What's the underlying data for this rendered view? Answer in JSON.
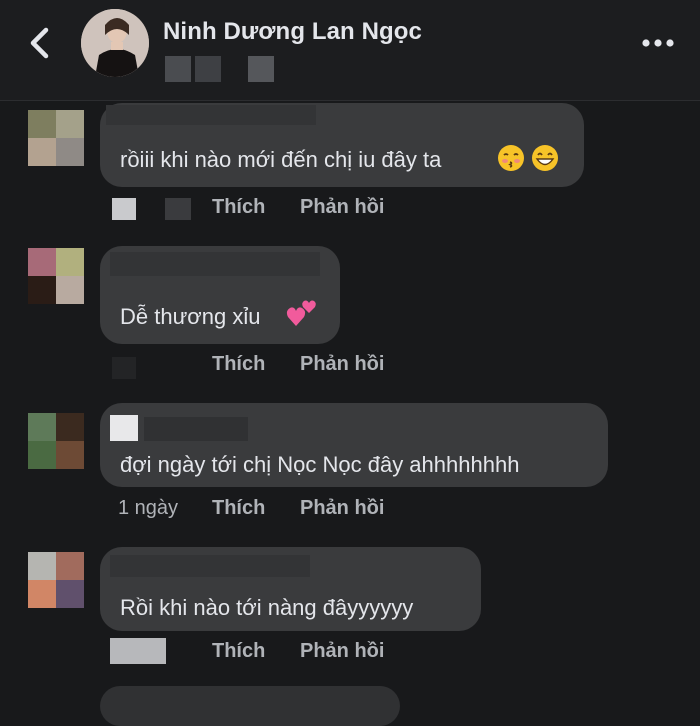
{
  "header": {
    "page_name": "Ninh Dương Lan Ngọc",
    "back_icon": "chevron-left-icon",
    "more_icon": "more-horizontal-icon"
  },
  "comments": [
    {
      "text": "rồiii khi nào mới đến chị iu đây ta",
      "emojis": [
        "kissing-face-emoji",
        "grinning-face-emoji"
      ],
      "like_label": "Thích",
      "reply_label": "Phản hồi",
      "avatar_colors": [
        "#7e7e5f",
        "#a4a18a",
        "#b3a290",
        "#8f8a86"
      ]
    },
    {
      "text": "Dễ thương xỉu",
      "emojis": [
        "two-hearts-emoji"
      ],
      "like_label": "Thích",
      "reply_label": "Phản hồi",
      "avatar_colors": [
        "#a76a78",
        "#b1b07e",
        "#2a1c16",
        "#b8aaa0"
      ]
    },
    {
      "text": "đợi ngày tới chị Nọc Nọc đây ahhhhhhhh",
      "time": "1 ngày",
      "like_label": "Thích",
      "reply_label": "Phản hồi",
      "avatar_colors": [
        "#5e7a59",
        "#3b2a1f",
        "#4a6a42",
        "#6d4a35"
      ]
    },
    {
      "text": "Rồi khi nào tới nàng đâyyyyyy",
      "like_label": "Thích",
      "reply_label": "Phản hồi",
      "avatar_colors": [
        "#b5b5b1",
        "#a16b5d",
        "#d18666",
        "#60506c"
      ]
    }
  ],
  "colors": {
    "background": "#18191b",
    "bubble": "#3a3b3d",
    "text_primary": "#e4e6eb",
    "text_secondary": "#b0b3b8"
  }
}
